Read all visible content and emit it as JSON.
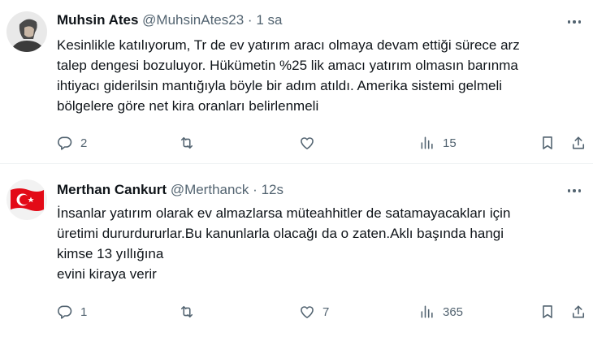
{
  "tweets": [
    {
      "name": "Muhsin Ates",
      "handle": "@MuhsinAtes23",
      "time": "1 sa",
      "text_lines": [
        "Kesinlikle katılıyorum, Tr de ev yatırım aracı olmaya devam ettiği sürece arz",
        "talep dengesi bozuluyor. Hükümetin %25 lik amacı yatırım olmasın barınma",
        "ihtiyacı giderilsin mantığıyla böyle bir adım atıldı. Amerika sistemi gelmeli",
        "bölgelere göre net kira oranları belirlenmeli"
      ],
      "replies": "2",
      "reposts": "",
      "likes": "",
      "views": "15",
      "avatar_icon": "person-photo-avatar"
    },
    {
      "name": "Merthan Cankurt",
      "handle": "@Merthanck",
      "time": "12s",
      "text_lines": [
        "İnsanlar yatırım olarak ev almazlarsa müteahhitler de satamayacakları için",
        "üretimi dururdururlar.Bu kanunlarla olacağı da o zaten.Aklı başında hangi",
        "kimse 13 yıllığına",
        "evini kiraya verir"
      ],
      "replies": "1",
      "reposts": "",
      "likes": "7",
      "views": "365",
      "avatar_icon": "turkish-flag-avatar"
    }
  ],
  "colors": {
    "text": "#0f1419",
    "muted": "#536471",
    "divider": "#eff3f4",
    "flag_red": "#e30a17"
  },
  "icons": [
    "reply-icon",
    "repost-icon",
    "like-icon",
    "views-icon",
    "bookmark-icon",
    "share-icon",
    "more-icon"
  ]
}
